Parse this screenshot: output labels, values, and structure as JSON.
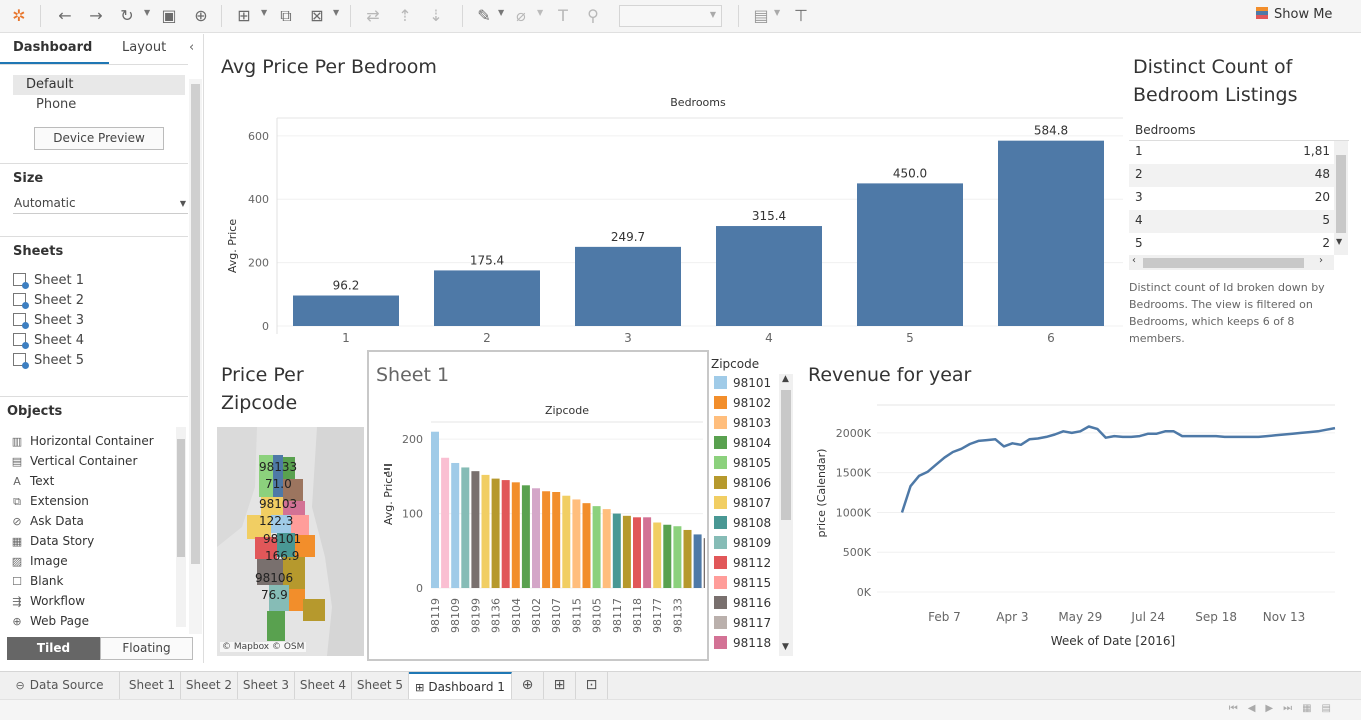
{
  "toolbar": {
    "show_me": "Show Me"
  },
  "left_panel": {
    "tab_dashboard": "Dashboard",
    "tab_layout": "Layout",
    "devices": [
      "Default",
      "Phone"
    ],
    "device_preview": "Device Preview",
    "size_heading": "Size",
    "size_value": "Automatic",
    "sheets_heading": "Sheets",
    "sheets": [
      "Sheet 1",
      "Sheet 2",
      "Sheet 3",
      "Sheet 4",
      "Sheet 5"
    ],
    "objects_heading": "Objects",
    "objects": [
      "Horizontal Container",
      "Vertical Container",
      "Text",
      "Extension",
      "Ask Data",
      "Data Story",
      "Image",
      "Blank",
      "Workflow",
      "Web Page"
    ],
    "tiled": "Tiled",
    "floating": "Floating"
  },
  "avg_price_chart": {
    "title": "Avg Price Per Bedroom",
    "x_header": "Bedrooms",
    "y_label": "Avg. Price",
    "y_ticks": [
      "0",
      "200",
      "400",
      "600"
    ],
    "bar_labels": [
      "96.2",
      "175.4",
      "249.7",
      "315.4",
      "450.0",
      "584.8"
    ]
  },
  "distinct_count": {
    "title_line1": "Distinct Count of",
    "title_line2": "Bedroom Listings",
    "col_header": "Bedrooms",
    "rows": [
      {
        "bed": "1",
        "val": "1,81"
      },
      {
        "bed": "2",
        "val": "48"
      },
      {
        "bed": "3",
        "val": "20"
      },
      {
        "bed": "4",
        "val": "5"
      },
      {
        "bed": "5",
        "val": "2"
      }
    ],
    "caption": "Distinct count of Id broken down by Bedrooms. The view is filtered on Bedrooms, which keeps 6 of 8 members."
  },
  "map_panel": {
    "title_line1": "Price Per",
    "title_line2": "Zipcode",
    "labels": [
      "98133",
      "71.0",
      "98103",
      "122.3",
      "98101",
      "166.9",
      "98106",
      "76.9"
    ],
    "attribution": "© Mapbox © OSM"
  },
  "sheet1": {
    "title": "Sheet 1",
    "x_header": "Zipcode",
    "y_label": "Avg. Price",
    "y_ticks": [
      "0",
      "100",
      "200"
    ]
  },
  "legend": {
    "title": "Zipcode",
    "items": [
      {
        "zip": "98101",
        "color": "#a0cbe8"
      },
      {
        "zip": "98102",
        "color": "#f28e2b"
      },
      {
        "zip": "98103",
        "color": "#ffbe7d"
      },
      {
        "zip": "98104",
        "color": "#59a14f"
      },
      {
        "zip": "98105",
        "color": "#8cd17d"
      },
      {
        "zip": "98106",
        "color": "#b6992d"
      },
      {
        "zip": "98107",
        "color": "#f1ce63"
      },
      {
        "zip": "98108",
        "color": "#499894"
      },
      {
        "zip": "98109",
        "color": "#86bcb6"
      },
      {
        "zip": "98112",
        "color": "#e15759"
      },
      {
        "zip": "98115",
        "color": "#ff9d9a"
      },
      {
        "zip": "98116",
        "color": "#79706e"
      },
      {
        "zip": "98117",
        "color": "#bab0ac"
      },
      {
        "zip": "98118",
        "color": "#d37295"
      }
    ]
  },
  "revenue_chart": {
    "title": "Revenue for year",
    "y_label": "price (Calendar)",
    "x_label": "Week of Date [2016]",
    "y_ticks": [
      "0K",
      "500K",
      "1000K",
      "1500K",
      "2000K"
    ],
    "x_ticks": [
      "Feb 7",
      "Apr 3",
      "May 29",
      "Jul 24",
      "Sep 18",
      "Nov 13"
    ]
  },
  "bottom_tabs": {
    "data_source": "Data Source",
    "sheets": [
      "Sheet 1",
      "Sheet 2",
      "Sheet 3",
      "Sheet 4",
      "Sheet 5"
    ],
    "dashboard": "Dashboard 1"
  },
  "colors": {
    "bar_blue": "#4e79a7",
    "accent": "#1f77b4"
  },
  "chart_data": [
    {
      "type": "bar",
      "title": "Avg Price Per Bedroom",
      "xlabel": "Bedrooms",
      "ylabel": "Avg. Price",
      "categories": [
        "1",
        "2",
        "3",
        "4",
        "5",
        "6"
      ],
      "values": [
        96.2,
        175.4,
        249.7,
        315.4,
        450.0,
        584.8
      ],
      "ylim": [
        0,
        650
      ]
    },
    {
      "type": "bar",
      "title": "Sheet 1",
      "xlabel": "Zipcode",
      "ylabel": "Avg. Price",
      "categories": [
        "98119",
        "98109",
        "98199",
        "98136",
        "98104",
        "98102",
        "98107",
        "98115",
        "98105",
        "98117",
        "98118",
        "98177",
        "98133"
      ],
      "bars": [
        {
          "value": 210,
          "color": "#a0cbe8"
        },
        {
          "value": 175,
          "color": "#fabfd2"
        },
        {
          "value": 168,
          "color": "#a0cbe8"
        },
        {
          "value": 162,
          "color": "#86bcb6"
        },
        {
          "value": 157,
          "color": "#79706e"
        },
        {
          "value": 152,
          "color": "#f1ce63"
        },
        {
          "value": 147,
          "color": "#b6992d"
        },
        {
          "value": 145,
          "color": "#e15759"
        },
        {
          "value": 142,
          "color": "#f28e2b"
        },
        {
          "value": 138,
          "color": "#59a14f"
        },
        {
          "value": 134,
          "color": "#d4a6c8"
        },
        {
          "value": 130,
          "color": "#f28e2b"
        },
        {
          "value": 129,
          "color": "#f28e2b"
        },
        {
          "value": 124,
          "color": "#f1ce63"
        },
        {
          "value": 119,
          "color": "#ffbe7d"
        },
        {
          "value": 114,
          "color": "#f28e2b"
        },
        {
          "value": 110,
          "color": "#8cd17d"
        },
        {
          "value": 106,
          "color": "#ffbe7d"
        },
        {
          "value": 100,
          "color": "#499894"
        },
        {
          "value": 97,
          "color": "#b6992d"
        },
        {
          "value": 95,
          "color": "#e15759"
        },
        {
          "value": 95,
          "color": "#d37295"
        },
        {
          "value": 88,
          "color": "#f1ce63"
        },
        {
          "value": 85,
          "color": "#59a14f"
        },
        {
          "value": 83,
          "color": "#8cd17d"
        },
        {
          "value": 78,
          "color": "#b6992d"
        },
        {
          "value": 72,
          "color": "#4e79a7"
        },
        {
          "value": 67,
          "color": "#79706e"
        }
      ],
      "ylim": [
        0,
        215
      ]
    },
    {
      "type": "line",
      "title": "Revenue for year",
      "xlabel": "Week of Date [2016]",
      "ylabel": "price (Calendar)",
      "x": [
        "Jan 3",
        "Jan 10",
        "Jan 17",
        "Jan 24",
        "Jan 31",
        "Feb 7",
        "Feb 14",
        "Feb 21",
        "Feb 28",
        "Mar 6",
        "Mar 13",
        "Mar 20",
        "Mar 27",
        "Apr 3",
        "Apr 10",
        "Apr 17",
        "Apr 24",
        "May 1",
        "May 8",
        "May 15",
        "May 22",
        "May 29",
        "Jun 5",
        "Jun 12",
        "Jun 19",
        "Jun 26",
        "Jul 3",
        "Jul 10",
        "Jul 17",
        "Jul 24",
        "Jul 31",
        "Aug 7",
        "Aug 14",
        "Aug 21",
        "Aug 28",
        "Sep 4",
        "Sep 11",
        "Sep 18",
        "Sep 25",
        "Oct 2",
        "Oct 9",
        "Oct 16",
        "Oct 23",
        "Oct 30",
        "Nov 6",
        "Nov 13",
        "Nov 20",
        "Nov 27",
        "Dec 4",
        "Dec 11",
        "Dec 18",
        "Dec 25"
      ],
      "series": [
        {
          "values": [
            1000000,
            1330000,
            1460000,
            1510000,
            1600000,
            1690000,
            1760000,
            1800000,
            1860000,
            1900000,
            1910000,
            1920000,
            1830000,
            1870000,
            1850000,
            1920000,
            1930000,
            1950000,
            1980000,
            2020000,
            2000000,
            2020000,
            2080000,
            2050000,
            1940000,
            1960000,
            1950000,
            1950000,
            1960000,
            1990000,
            1990000,
            2020000,
            2020000,
            1960000,
            1960000,
            1960000,
            1960000,
            1960000,
            1950000,
            1950000,
            1950000,
            1950000,
            1950000,
            1960000,
            1970000,
            1980000,
            1990000,
            2000000,
            2010000,
            2020000,
            2040000,
            2060000
          ]
        }
      ],
      "ylim": [
        0,
        2200000
      ]
    }
  ]
}
